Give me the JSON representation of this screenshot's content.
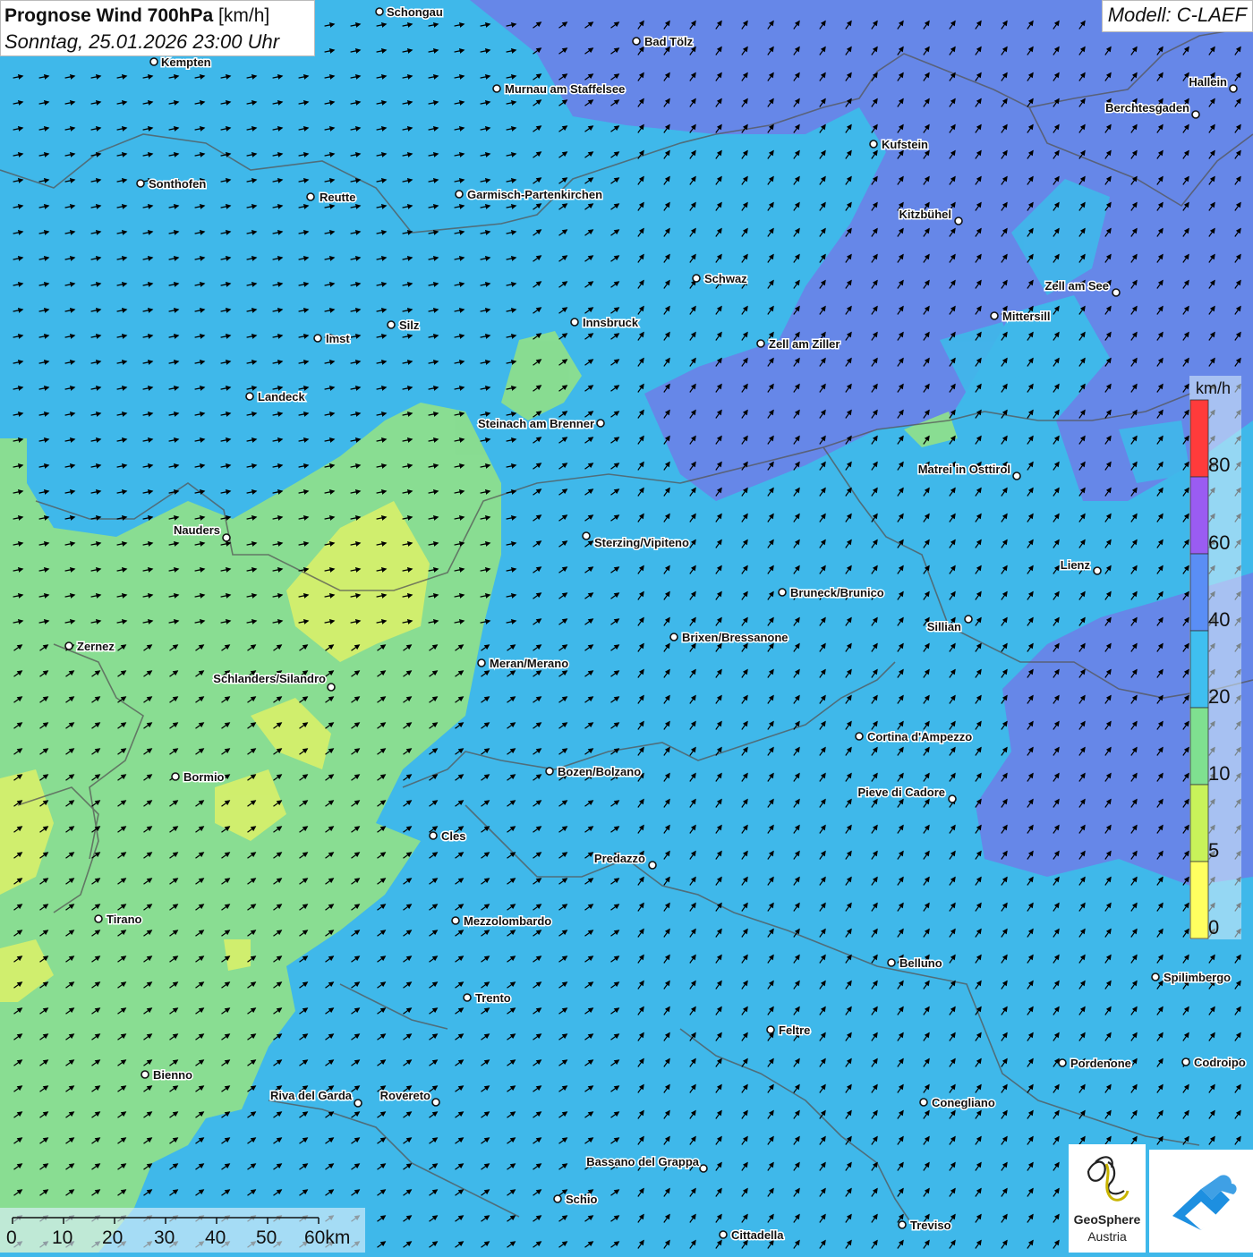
{
  "header": {
    "title_bold": "Prognose Wind 700hPa",
    "title_unit": "[km/h]",
    "datetime": "Sonntag, 25.01.2026 23:00 Uhr",
    "model": "Modell: C-LAEF"
  },
  "legend": {
    "unit": "km/h",
    "labels": [
      "80",
      "60",
      "40",
      "20",
      "10",
      "5",
      "0"
    ],
    "colors": [
      "#ff3b3b",
      "#9a5cf2",
      "#5a8ef5",
      "#3fbff0",
      "#7fe090",
      "#c8f25a",
      "#ffff60"
    ]
  },
  "scale_bar": {
    "labels": [
      "0",
      "10",
      "20",
      "30",
      "40",
      "50",
      "60km"
    ]
  },
  "logos": {
    "geosphere_line1": "GeoSphere",
    "geosphere_line2": "Austria"
  },
  "cities": [
    {
      "name": "Schongau"
    },
    {
      "name": "Bad Tölz"
    },
    {
      "name": "Kempten"
    },
    {
      "name": "Murnau am Staffelsee"
    },
    {
      "name": "Hallein"
    },
    {
      "name": "Berchtesgaden"
    },
    {
      "name": "Kufstein"
    },
    {
      "name": "Sonthofen"
    },
    {
      "name": "Reutte"
    },
    {
      "name": "Garmisch-Partenkirchen"
    },
    {
      "name": "Kitzbühel"
    },
    {
      "name": "Schwaz"
    },
    {
      "name": "Zell am See"
    },
    {
      "name": "Mittersill"
    },
    {
      "name": "Innsbruck"
    },
    {
      "name": "Silz"
    },
    {
      "name": "Imst"
    },
    {
      "name": "Zell am Ziller"
    },
    {
      "name": "Landeck"
    },
    {
      "name": "Steinach am Brenner"
    },
    {
      "name": "Matrei in Osttirol"
    },
    {
      "name": "Nauders"
    },
    {
      "name": "Sterzing/Vipiteno"
    },
    {
      "name": "Lienz"
    },
    {
      "name": "Bruneck/Brunico"
    },
    {
      "name": "Sillian"
    },
    {
      "name": "Zernez"
    },
    {
      "name": "Brixen/Bressanone"
    },
    {
      "name": "Meran/Merano"
    },
    {
      "name": "Schlanders/Silandro"
    },
    {
      "name": "Cortina d'Ampezzo"
    },
    {
      "name": "Bozen/Bolzano"
    },
    {
      "name": "Bormio"
    },
    {
      "name": "Pieve di Cadore"
    },
    {
      "name": "Cles"
    },
    {
      "name": "Predazzo"
    },
    {
      "name": "Tirano"
    },
    {
      "name": "Mezzolombardo"
    },
    {
      "name": "Belluno"
    },
    {
      "name": "Spilimbergo"
    },
    {
      "name": "Trento"
    },
    {
      "name": "Feltre"
    },
    {
      "name": "Pordenone"
    },
    {
      "name": "Codroipo"
    },
    {
      "name": "Bienno"
    },
    {
      "name": "Riva del Garda"
    },
    {
      "name": "Rovereto"
    },
    {
      "name": "Conegliano"
    },
    {
      "name": "Bassano del Grappa"
    },
    {
      "name": "Schio"
    },
    {
      "name": "Treviso"
    },
    {
      "name": "Cittadella"
    }
  ]
}
